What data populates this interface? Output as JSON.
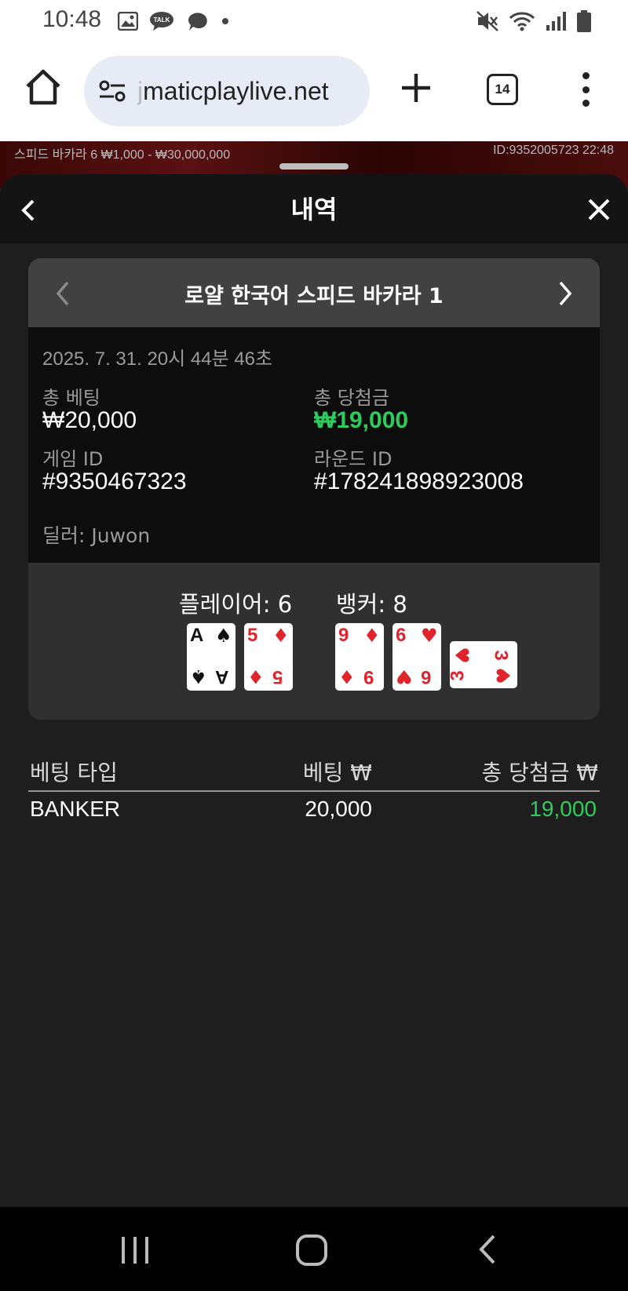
{
  "status_bar": {
    "time": "10:48",
    "left_icons": [
      "image-icon",
      "kakaotalk-icon",
      "chat-bubble-icon",
      "dot-icon"
    ],
    "right_icons": [
      "mute-icon",
      "wifi-icon",
      "signal-icon",
      "battery-icon"
    ]
  },
  "browser": {
    "url_faded": "j",
    "url": "maticplaylive.net",
    "tab_count": "14"
  },
  "game_strip": {
    "left_text": "스피드 바카라 6  ₩1,000 - ₩30,000,000",
    "right_text": "ID:9352005723  22:48"
  },
  "sheet": {
    "title": "내역"
  },
  "card": {
    "title": "로얄 한국어 스피드 바카라 1",
    "date": "2025. 7. 31. 20시 44분 46초",
    "total_bet_label": "총 베팅",
    "total_bet_value": "₩20,000",
    "total_win_label": "총 당첨금",
    "total_win_value": "₩19,000",
    "game_id_label": "게임 ID",
    "game_id_value": "#9350467323",
    "round_id_label": "라운드 ID",
    "round_id_value": "#178241898923008",
    "dealer": "딜러: Juwon",
    "player_label": "플레이어: 6",
    "banker_label": "뱅커: 8",
    "player_cards": [
      {
        "rank": "A",
        "suit": "♠",
        "color": "#111111"
      },
      {
        "rank": "5",
        "suit": "♦",
        "color": "#e0242c"
      }
    ],
    "banker_cards": [
      {
        "rank": "9",
        "suit": "♦",
        "color": "#e0242c"
      },
      {
        "rank": "6",
        "suit": "♥",
        "color": "#e0242c"
      },
      {
        "rank": "3",
        "suit": "♥",
        "color": "#e0242c"
      }
    ]
  },
  "bets": {
    "col_type": "베팅 타입",
    "col_bet": "베팅 ₩",
    "col_win": "총 당첨금 ₩",
    "rows": [
      {
        "type": "BANKER",
        "bet": "20,000",
        "win": "19,000"
      }
    ]
  },
  "colors": {
    "win_green": "#2ecc5e",
    "card_red": "#e0242c",
    "background": "#1e1e1e"
  }
}
